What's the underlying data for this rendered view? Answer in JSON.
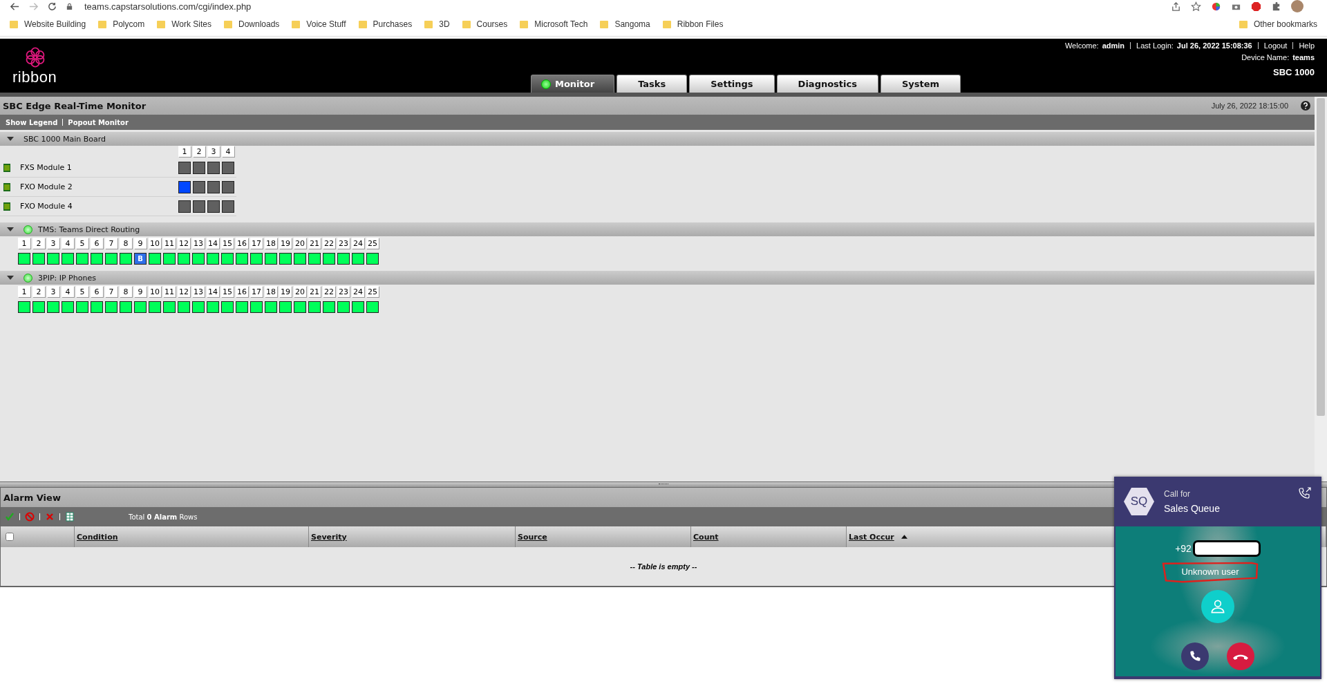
{
  "browser": {
    "url": "teams.capstarsolutions.com/cgi/index.php",
    "bookmarks": [
      "Website Building",
      "Polycom",
      "Work Sites",
      "Downloads",
      "Voice Stuff",
      "Purchases",
      "3D",
      "Courses",
      "Microsoft Tech",
      "Sangoma",
      "Ribbon Files"
    ],
    "other_bookmarks": "Other bookmarks"
  },
  "header": {
    "logo_text": "ribbon",
    "welcome_label": "Welcome:",
    "user": "admin",
    "last_login_label": "Last Login:",
    "last_login": "Jul 26, 2022 15:08:36",
    "links": [
      "Logout",
      "Help"
    ],
    "device_name_label": "Device Name:",
    "device_name": "teams",
    "model": "SBC 1000",
    "tabs": [
      {
        "label": "Monitor",
        "selected": true
      },
      {
        "label": "Tasks",
        "selected": false
      },
      {
        "label": "Settings",
        "selected": false
      },
      {
        "label": "Diagnostics",
        "selected": false
      },
      {
        "label": "System",
        "selected": false
      }
    ]
  },
  "monitor": {
    "title": "SBC Edge Real-Time Monitor",
    "timestamp": "July 26, 2022 18:15:00",
    "links": [
      "Show Legend",
      "Popout Monitor"
    ],
    "sections": [
      {
        "kind": "modules",
        "title": "SBC 1000 Main Board",
        "expanded": true,
        "port_numbers": [
          "1",
          "2",
          "3",
          "4"
        ],
        "modules": [
          {
            "name": "FXS Module 1",
            "ports": [
              {
                "color": "#606060"
              },
              {
                "color": "#606060"
              },
              {
                "color": "#606060"
              },
              {
                "color": "#606060"
              }
            ]
          },
          {
            "name": "FXO Module 2",
            "ports": [
              {
                "color": "#0047ff"
              },
              {
                "color": "#606060"
              },
              {
                "color": "#606060"
              },
              {
                "color": "#606060"
              }
            ]
          },
          {
            "name": "FXO Module 4",
            "ports": [
              {
                "color": "#606060"
              },
              {
                "color": "#606060"
              },
              {
                "color": "#606060"
              },
              {
                "color": "#606060"
              }
            ]
          }
        ]
      },
      {
        "kind": "channels",
        "title": "TMS: Teams Direct Routing",
        "expanded": true,
        "online": true,
        "port_numbers": [
          "1",
          "2",
          "3",
          "4",
          "5",
          "6",
          "7",
          "8",
          "9",
          "10",
          "11",
          "12",
          "13",
          "14",
          "15",
          "16",
          "17",
          "18",
          "19",
          "20",
          "21",
          "22",
          "23",
          "24",
          "25"
        ],
        "ports": [
          {
            "color": "#00ff5a"
          },
          {
            "color": "#00ff5a"
          },
          {
            "color": "#00ff5a"
          },
          {
            "color": "#00ff5a"
          },
          {
            "color": "#00ff5a"
          },
          {
            "color": "#00ff5a"
          },
          {
            "color": "#00ff5a"
          },
          {
            "color": "#00ff5a"
          },
          {
            "color": "#2f6fe8",
            "label": "B"
          },
          {
            "color": "#00ff5a"
          },
          {
            "color": "#00ff5a"
          },
          {
            "color": "#00ff5a"
          },
          {
            "color": "#00ff5a"
          },
          {
            "color": "#00ff5a"
          },
          {
            "color": "#00ff5a"
          },
          {
            "color": "#00ff5a"
          },
          {
            "color": "#00ff5a"
          },
          {
            "color": "#00ff5a"
          },
          {
            "color": "#00ff5a"
          },
          {
            "color": "#00ff5a"
          },
          {
            "color": "#00ff5a"
          },
          {
            "color": "#00ff5a"
          },
          {
            "color": "#00ff5a"
          },
          {
            "color": "#00ff5a"
          },
          {
            "color": "#00ff5a"
          }
        ]
      },
      {
        "kind": "channels",
        "title": "3PIP: IP Phones",
        "expanded": true,
        "online": true,
        "port_numbers": [
          "1",
          "2",
          "3",
          "4",
          "5",
          "6",
          "7",
          "8",
          "9",
          "10",
          "11",
          "12",
          "13",
          "14",
          "15",
          "16",
          "17",
          "18",
          "19",
          "20",
          "21",
          "22",
          "23",
          "24",
          "25"
        ],
        "ports": [
          {
            "color": "#00ff5a"
          },
          {
            "color": "#00ff5a"
          },
          {
            "color": "#00ff5a"
          },
          {
            "color": "#00ff5a"
          },
          {
            "color": "#00ff5a"
          },
          {
            "color": "#00ff5a"
          },
          {
            "color": "#00ff5a"
          },
          {
            "color": "#00ff5a"
          },
          {
            "color": "#00ff5a"
          },
          {
            "color": "#00ff5a"
          },
          {
            "color": "#00ff5a"
          },
          {
            "color": "#00ff5a"
          },
          {
            "color": "#00ff5a"
          },
          {
            "color": "#00ff5a"
          },
          {
            "color": "#00ff5a"
          },
          {
            "color": "#00ff5a"
          },
          {
            "color": "#00ff5a"
          },
          {
            "color": "#00ff5a"
          },
          {
            "color": "#00ff5a"
          },
          {
            "color": "#00ff5a"
          },
          {
            "color": "#00ff5a"
          },
          {
            "color": "#00ff5a"
          },
          {
            "color": "#00ff5a"
          },
          {
            "color": "#00ff5a"
          },
          {
            "color": "#00ff5a"
          }
        ]
      }
    ]
  },
  "alarms": {
    "title": "Alarm View",
    "total": "Total **0 Alarm** Rows",
    "select_all": {
      "checked": false
    },
    "columns": [
      {
        "label": "Condition",
        "sorted": false
      },
      {
        "label": "Severity",
        "sorted": false
      },
      {
        "label": "Source",
        "sorted": false
      },
      {
        "label": "Count",
        "sorted": false
      },
      {
        "label": "Last Occur",
        "sorted": true
      }
    ],
    "empty_message": "-- Table is empty --"
  },
  "call": {
    "avatar": "SQ",
    "caption": "Call for",
    "queue": "Sales Queue",
    "number": "+92",
    "caller": "Unknown user"
  }
}
